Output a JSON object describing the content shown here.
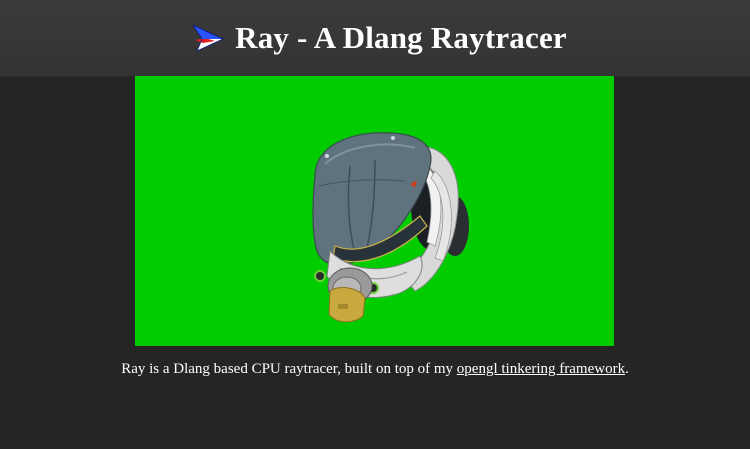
{
  "header": {
    "title": "Ray - A Dlang Raytracer",
    "logo_icon": "paper-plane-icon"
  },
  "render": {
    "background_color": "#00cc00",
    "subject": "helmet-render"
  },
  "caption": {
    "text_before": "Ray is a Dlang based CPU raytracer, built on top of my ",
    "link_text": "opengl tinkering framework",
    "text_after": "."
  },
  "colors": {
    "page_background": "#252525",
    "header_background": "#383838",
    "text": "#ffffff"
  }
}
